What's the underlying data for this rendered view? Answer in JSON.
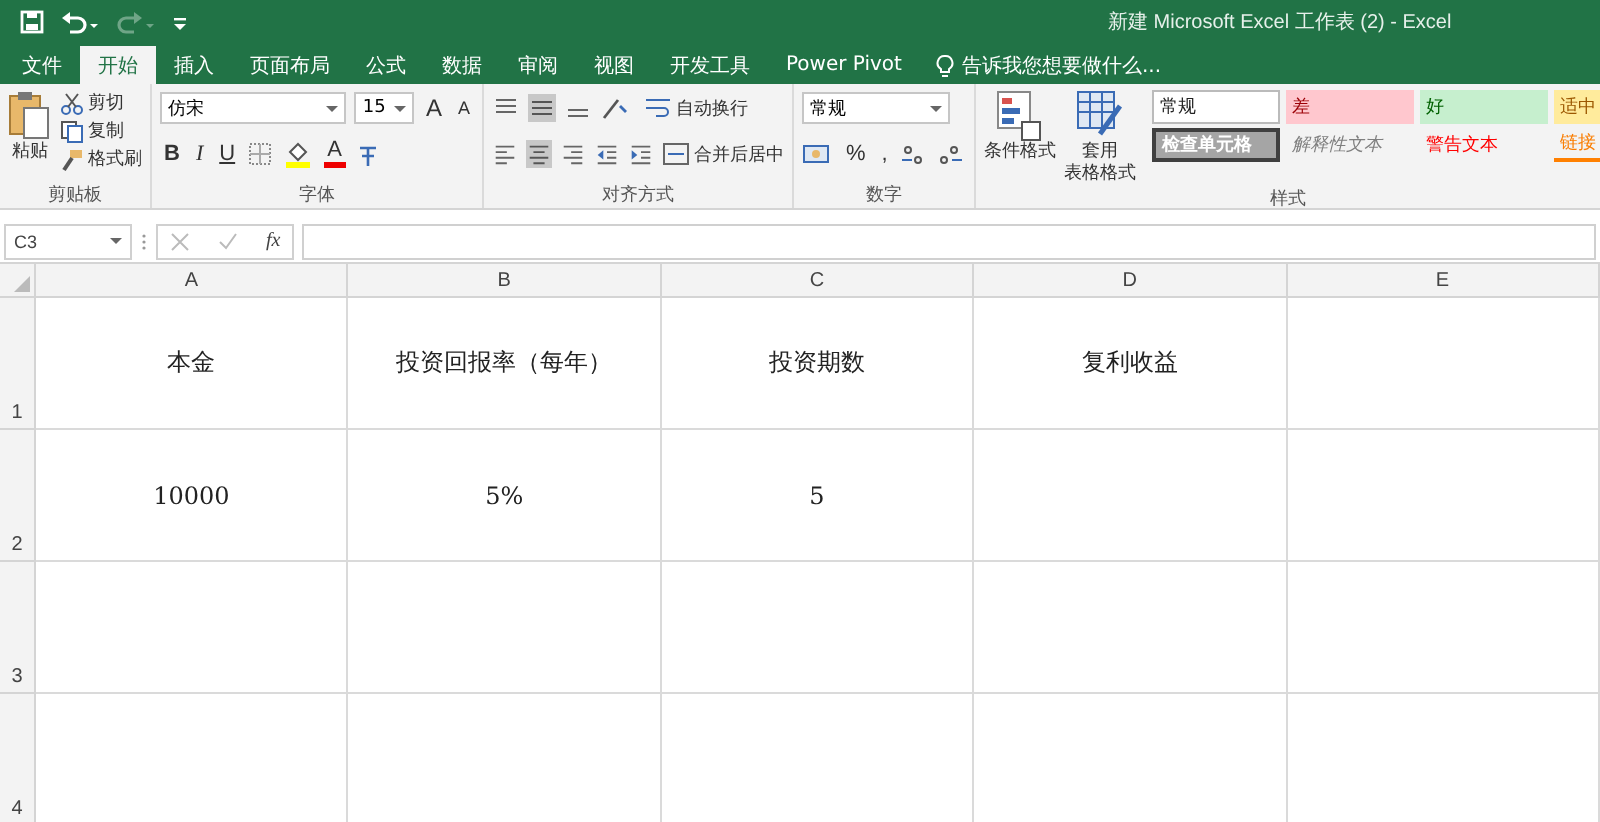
{
  "window": {
    "title": "新建 Microsoft Excel 工作表 (2) - Excel"
  },
  "tabs": [
    {
      "label": "文件",
      "selected": false
    },
    {
      "label": "开始",
      "selected": true
    },
    {
      "label": "插入",
      "selected": false
    },
    {
      "label": "页面布局",
      "selected": false
    },
    {
      "label": "公式",
      "selected": false
    },
    {
      "label": "数据",
      "selected": false
    },
    {
      "label": "审阅",
      "selected": false
    },
    {
      "label": "视图",
      "selected": false
    },
    {
      "label": "开发工具",
      "selected": false
    },
    {
      "label": "Power Pivot",
      "selected": false
    }
  ],
  "tell_me": "告诉我您想要做什么...",
  "clipboard": {
    "paste": "粘贴",
    "cut": "剪切",
    "copy": "复制",
    "format_painter": "格式刷",
    "group": "剪贴板"
  },
  "font": {
    "name": "仿宋",
    "size": "15",
    "grow": "A",
    "shrink": "A",
    "bold": "B",
    "italic": "I",
    "underline": "U",
    "font_color_letter": "A",
    "group": "字体"
  },
  "alignment": {
    "wrap": "自动换行",
    "merge": "合并后居中",
    "group": "对齐方式"
  },
  "number": {
    "format": "常规",
    "percent": "%",
    "comma": ",",
    "group": "数字"
  },
  "styles": {
    "conditional": "条件格式",
    "table_format": "套用",
    "table_format_2": "表格格式",
    "group": "样式",
    "cells": [
      {
        "label": "常规",
        "kind": "normal"
      },
      {
        "label": "差",
        "kind": "bad"
      },
      {
        "label": "好",
        "kind": "good"
      },
      {
        "label": "适中",
        "kind": "neutral"
      },
      {
        "label": "检查单元格",
        "kind": "check"
      },
      {
        "label": "解释性文本",
        "kind": "explanatory"
      },
      {
        "label": "警告文本",
        "kind": "warning"
      },
      {
        "label": "链接",
        "kind": "linked"
      }
    ]
  },
  "formula_bar": {
    "name_box": "C3",
    "fx": "fx"
  },
  "sheet": {
    "columns": [
      "A",
      "B",
      "C",
      "D",
      "E"
    ],
    "rows": [
      {
        "number": "1",
        "cells": [
          "本金",
          "投资回报率（每年）",
          "投资期数",
          "复利收益"
        ]
      },
      {
        "number": "2",
        "cells": [
          "10000",
          "5%",
          "5"
        ]
      },
      {
        "number": "3",
        "cells": []
      },
      {
        "number": "4",
        "cells": []
      }
    ]
  }
}
